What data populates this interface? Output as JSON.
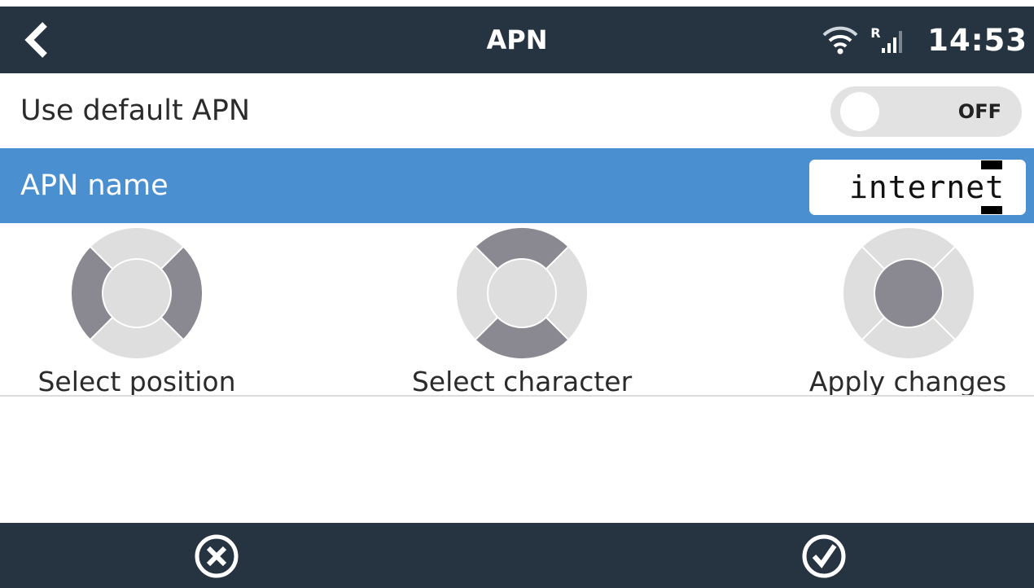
{
  "header": {
    "title": "APN",
    "time": "14:53",
    "roaming_indicator": "R",
    "back_icon": "chevron-left-icon",
    "wifi_icon": "wifi-icon",
    "signal_icon": "cellular-signal-icon"
  },
  "settings": {
    "default_apn": {
      "label": "Use default APN",
      "toggle_state": "OFF"
    },
    "apn_name": {
      "label": "APN name",
      "value": "internet"
    }
  },
  "help": [
    {
      "label": "Select position",
      "icon": "dpad-left-right-icon"
    },
    {
      "label": "Select character",
      "icon": "dpad-up-down-icon"
    },
    {
      "label": "Apply changes",
      "icon": "dpad-center-icon"
    }
  ],
  "footer": {
    "cancel_icon": "cancel-circle-icon",
    "confirm_icon": "confirm-circle-icon"
  },
  "colors": {
    "header_bg": "#263442",
    "selected_row": "#4a8fd0",
    "dial_light": "#dedede",
    "dial_dark": "#8a8991"
  }
}
